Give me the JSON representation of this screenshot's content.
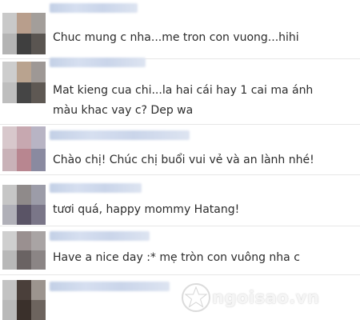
{
  "comments": [
    {
      "text": "Chuc mung c nha...me tron con vuong...hihi"
    },
    {
      "text": "Mat kieng cua chi...la hai cái hay 1 cai ma ánh",
      "text2": "màu khac vay c? Dep wa"
    },
    {
      "text": "Chào chị! Chúc chị buổi vui vẻ và an lành nhé!"
    },
    {
      "text": "tươi quá, happy mommy Hatang!"
    },
    {
      "text": "Have a nice day :* mẹ tròn con vuông nha c"
    }
  ],
  "watermark": {
    "text": "ngoisao.vn"
  },
  "colors": {
    "text": "#2b2b2b",
    "divider": "#e7e7e7",
    "name_blur": "#c9d4ea"
  }
}
